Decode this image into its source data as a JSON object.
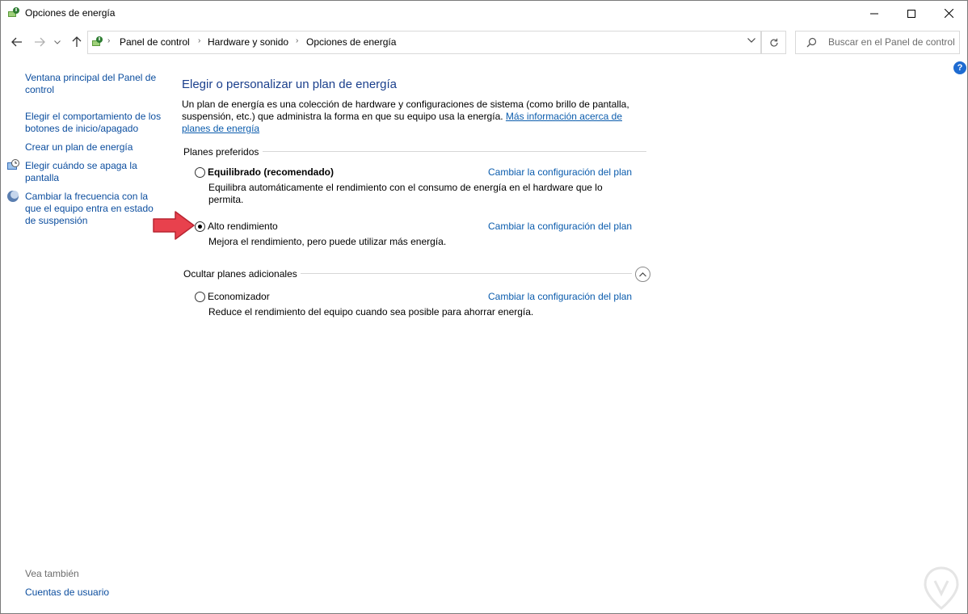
{
  "window": {
    "title": "Opciones de energía",
    "icon": "power-options-icon"
  },
  "nav": {
    "breadcrumbs": [
      "Panel de control",
      "Hardware y sonido",
      "Opciones de energía"
    ],
    "search_placeholder": "Buscar en el Panel de control"
  },
  "sidebar": {
    "links": [
      {
        "label": "Ventana principal del Panel de control"
      },
      {
        "label": "Elegir el comportamiento de los botones de inicio/apagado"
      },
      {
        "label": "Crear un plan de energía"
      },
      {
        "label": "Elegir cuándo se apaga la pantalla"
      },
      {
        "label": "Cambiar la frecuencia con la que el equipo entra en estado de suspensión"
      }
    ],
    "see_also_label": "Vea también",
    "see_also_links": [
      {
        "label": "Cuentas de usuario"
      }
    ]
  },
  "main": {
    "heading": "Elegir o personalizar un plan de energía",
    "intro": "Un plan de energía es una colección de hardware y configuraciones de sistema (como brillo de pantalla, suspensión, etc.) que administra la forma en que su equipo usa la energía.",
    "intro_link": "Más información acerca de planes de energía",
    "preferred_label": "Planes preferidos",
    "additional_label": "Ocultar planes adicionales",
    "change_link": "Cambiar la configuración del plan",
    "plans": [
      {
        "name": "Equilibrado (recomendado)",
        "description": "Equilibra automáticamente el rendimiento con el consumo de energía en el hardware que lo permita.",
        "selected": false
      },
      {
        "name": "Alto rendimiento",
        "description": "Mejora el rendimiento, pero puede utilizar más energía.",
        "selected": true
      },
      {
        "name": "Economizador",
        "description": "Reduce el rendimiento del equipo cuando sea posible para ahorrar energía.",
        "selected": false
      }
    ]
  },
  "colors": {
    "link": "#0b5cad",
    "heading": "#1a3f8c",
    "annotation_arrow": "#e8414d"
  }
}
